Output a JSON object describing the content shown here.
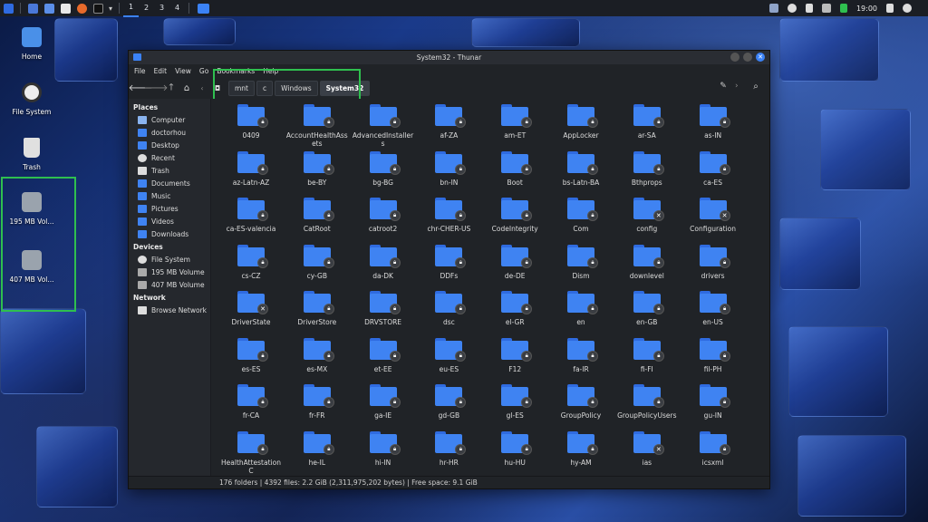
{
  "panel": {
    "workspaces": [
      "1",
      "2",
      "3",
      "4"
    ],
    "active_workspace": "1",
    "clock": "19:00",
    "colors": {
      "accent": "#3b82f6"
    }
  },
  "desktop": {
    "icons": [
      {
        "label": "Home",
        "icon": "home-icon"
      },
      {
        "label": "File System",
        "icon": "drive-icon"
      },
      {
        "label": "Trash",
        "icon": "trash-icon"
      },
      {
        "label": "195 MB Vol...",
        "icon": "volume-icon"
      },
      {
        "label": "407 MB Vol...",
        "icon": "volume-icon"
      }
    ]
  },
  "window": {
    "title": "System32 - Thunar",
    "menu": [
      "File",
      "Edit",
      "View",
      "Go",
      "Bookmarks",
      "Help"
    ],
    "breadcrumb": [
      "mnt",
      "c",
      "Windows",
      "System32"
    ],
    "sidebar": {
      "places_title": "Places",
      "places": [
        "Computer",
        "doctorhou",
        "Desktop",
        "Recent",
        "Trash",
        "Documents",
        "Music",
        "Pictures",
        "Videos",
        "Downloads"
      ],
      "devices_title": "Devices",
      "devices": [
        "File System",
        "195 MB Volume",
        "407 MB Volume"
      ],
      "network_title": "Network",
      "network": [
        "Browse Network"
      ]
    },
    "folders": [
      {
        "name": "0409",
        "badge": "lock"
      },
      {
        "name": "AccountHealthAssets",
        "badge": "lock"
      },
      {
        "name": "AdvancedInstallers",
        "badge": "lock"
      },
      {
        "name": "af-ZA",
        "badge": "lock"
      },
      {
        "name": "am-ET",
        "badge": "lock"
      },
      {
        "name": "AppLocker",
        "badge": "lock"
      },
      {
        "name": "ar-SA",
        "badge": "lock"
      },
      {
        "name": "as-IN",
        "badge": "lock"
      },
      {
        "name": "az-Latn-AZ",
        "badge": "lock"
      },
      {
        "name": "be-BY",
        "badge": "lock"
      },
      {
        "name": "bg-BG",
        "badge": "lock"
      },
      {
        "name": "bn-IN",
        "badge": "lock"
      },
      {
        "name": "Boot",
        "badge": "lock"
      },
      {
        "name": "bs-Latn-BA",
        "badge": "lock"
      },
      {
        "name": "Bthprops",
        "badge": "lock"
      },
      {
        "name": "ca-ES",
        "badge": "lock"
      },
      {
        "name": "ca-ES-valencia",
        "badge": "lock"
      },
      {
        "name": "CatRoot",
        "badge": "lock"
      },
      {
        "name": "catroot2",
        "badge": "lock"
      },
      {
        "name": "chr-CHER-US",
        "badge": "lock"
      },
      {
        "name": "CodeIntegrity",
        "badge": "lock"
      },
      {
        "name": "Com",
        "badge": "lock"
      },
      {
        "name": "config",
        "badge": "x"
      },
      {
        "name": "Configuration",
        "badge": "x"
      },
      {
        "name": "cs-CZ",
        "badge": "lock"
      },
      {
        "name": "cy-GB",
        "badge": "lock"
      },
      {
        "name": "da-DK",
        "badge": "lock"
      },
      {
        "name": "DDFs",
        "badge": "lock"
      },
      {
        "name": "de-DE",
        "badge": "lock"
      },
      {
        "name": "Dism",
        "badge": "lock"
      },
      {
        "name": "downlevel",
        "badge": "lock"
      },
      {
        "name": "drivers",
        "badge": "lock"
      },
      {
        "name": "DriverState",
        "badge": "x"
      },
      {
        "name": "DriverStore",
        "badge": "lock"
      },
      {
        "name": "DRVSTORE",
        "badge": "lock"
      },
      {
        "name": "dsc",
        "badge": "lock"
      },
      {
        "name": "el-GR",
        "badge": "lock"
      },
      {
        "name": "en",
        "badge": "lock"
      },
      {
        "name": "en-GB",
        "badge": "lock"
      },
      {
        "name": "en-US",
        "badge": "lock"
      },
      {
        "name": "es-ES",
        "badge": "lock"
      },
      {
        "name": "es-MX",
        "badge": "lock"
      },
      {
        "name": "et-EE",
        "badge": "lock"
      },
      {
        "name": "eu-ES",
        "badge": "lock"
      },
      {
        "name": "F12",
        "badge": "lock"
      },
      {
        "name": "fa-IR",
        "badge": "lock"
      },
      {
        "name": "fi-FI",
        "badge": "lock"
      },
      {
        "name": "fil-PH",
        "badge": "lock"
      },
      {
        "name": "fr-CA",
        "badge": "lock"
      },
      {
        "name": "fr-FR",
        "badge": "lock"
      },
      {
        "name": "ga-IE",
        "badge": "lock"
      },
      {
        "name": "gd-GB",
        "badge": "lock"
      },
      {
        "name": "gl-ES",
        "badge": "lock"
      },
      {
        "name": "GroupPolicy",
        "badge": "lock"
      },
      {
        "name": "GroupPolicyUsers",
        "badge": "lock"
      },
      {
        "name": "gu-IN",
        "badge": "lock"
      },
      {
        "name": "HealthAttestationC",
        "badge": "lock"
      },
      {
        "name": "he-IL",
        "badge": "lock"
      },
      {
        "name": "hi-IN",
        "badge": "lock"
      },
      {
        "name": "hr-HR",
        "badge": "lock"
      },
      {
        "name": "hu-HU",
        "badge": "lock"
      },
      {
        "name": "hy-AM",
        "badge": "lock"
      },
      {
        "name": "ias",
        "badge": "x"
      },
      {
        "name": "icsxml",
        "badge": "lock"
      }
    ],
    "status": "176 folders  |  4392 files: 2.2 GiB (2,311,975,202 bytes)  |  Free space: 9.1 GiB",
    "colors": {
      "folder": "#3f83f2",
      "highlight": "#2fbf4f"
    }
  }
}
